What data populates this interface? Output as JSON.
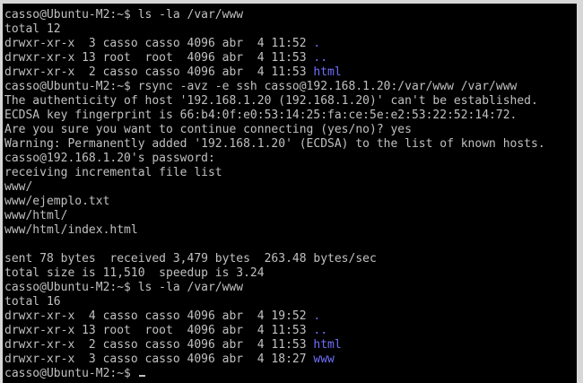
{
  "terminal": {
    "lines": [
      [
        {
          "t": "casso@Ubuntu-M2:~$ ls -la /var/www"
        }
      ],
      [
        {
          "t": "total 12"
        }
      ],
      [
        {
          "t": "drwxr-xr-x  3 casso casso 4096 abr  4 11:52 "
        },
        {
          "t": ".",
          "c": "blue"
        }
      ],
      [
        {
          "t": "drwxr-xr-x 13 root  root  4096 abr  4 11:53 "
        },
        {
          "t": "..",
          "c": "blue"
        }
      ],
      [
        {
          "t": "drwxr-xr-x  2 casso casso 4096 abr  4 11:53 "
        },
        {
          "t": "html",
          "c": "blue"
        }
      ],
      [
        {
          "t": "casso@Ubuntu-M2:~$ rsync -avz -e ssh casso@192.168.1.20:/var/www /var/www"
        }
      ],
      [
        {
          "t": "The authenticity of host '192.168.1.20 (192.168.1.20)' can't be established."
        }
      ],
      [
        {
          "t": "ECDSA key fingerprint is 66:b4:0f:e0:53:14:25:fa:ce:5e:e2:53:22:52:14:72."
        }
      ],
      [
        {
          "t": "Are you sure you want to continue connecting (yes/no)? yes"
        }
      ],
      [
        {
          "t": "Warning: Permanently added '192.168.1.20' (ECDSA) to the list of known hosts."
        }
      ],
      [
        {
          "t": "casso@192.168.1.20's password:"
        }
      ],
      [
        {
          "t": "receiving incremental file list"
        }
      ],
      [
        {
          "t": "www/"
        }
      ],
      [
        {
          "t": "www/ejemplo.txt"
        }
      ],
      [
        {
          "t": "www/html/"
        }
      ],
      [
        {
          "t": "www/html/index.html"
        }
      ],
      [
        {
          "t": ""
        }
      ],
      [
        {
          "t": "sent 78 bytes  received 3,479 bytes  263.48 bytes/sec"
        }
      ],
      [
        {
          "t": "total size is 11,510  speedup is 3.24"
        }
      ],
      [
        {
          "t": "casso@Ubuntu-M2:~$ ls -la /var/www"
        }
      ],
      [
        {
          "t": "total 16"
        }
      ],
      [
        {
          "t": "drwxr-xr-x  4 casso casso 4096 abr  4 19:52 "
        },
        {
          "t": ".",
          "c": "blue"
        }
      ],
      [
        {
          "t": "drwxr-xr-x 13 root  root  4096 abr  4 11:53 "
        },
        {
          "t": "..",
          "c": "blue"
        }
      ],
      [
        {
          "t": "drwxr-xr-x  2 casso casso 4096 abr  4 11:53 "
        },
        {
          "t": "html",
          "c": "blue"
        }
      ],
      [
        {
          "t": "drwxr-xr-x  3 casso casso 4096 abr  4 18:27 "
        },
        {
          "t": "www",
          "c": "blue"
        }
      ],
      [
        {
          "t": "casso@Ubuntu-M2:~$ "
        }
      ]
    ],
    "colors": {
      "background": "#000000",
      "foreground": "#c0c0c0",
      "directory": "#6f6fff",
      "frame": "#d7d7d7"
    }
  }
}
